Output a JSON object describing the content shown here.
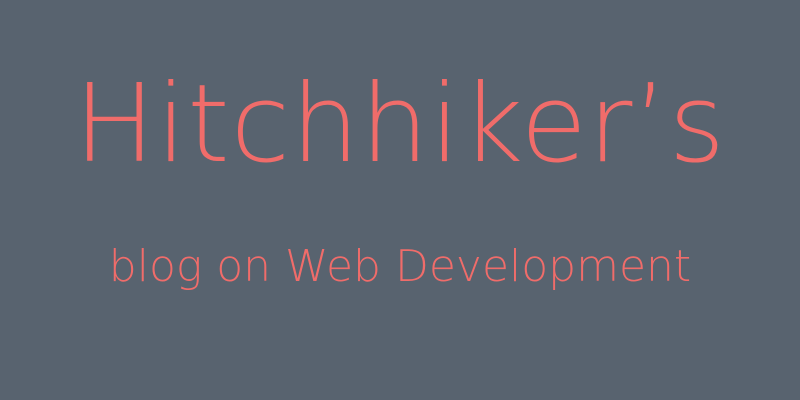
{
  "banner": {
    "title": "Hitchhiker’s",
    "subtitle": "blog on Web Development",
    "background_color": "#58636f",
    "text_color": "#f06c6a"
  }
}
